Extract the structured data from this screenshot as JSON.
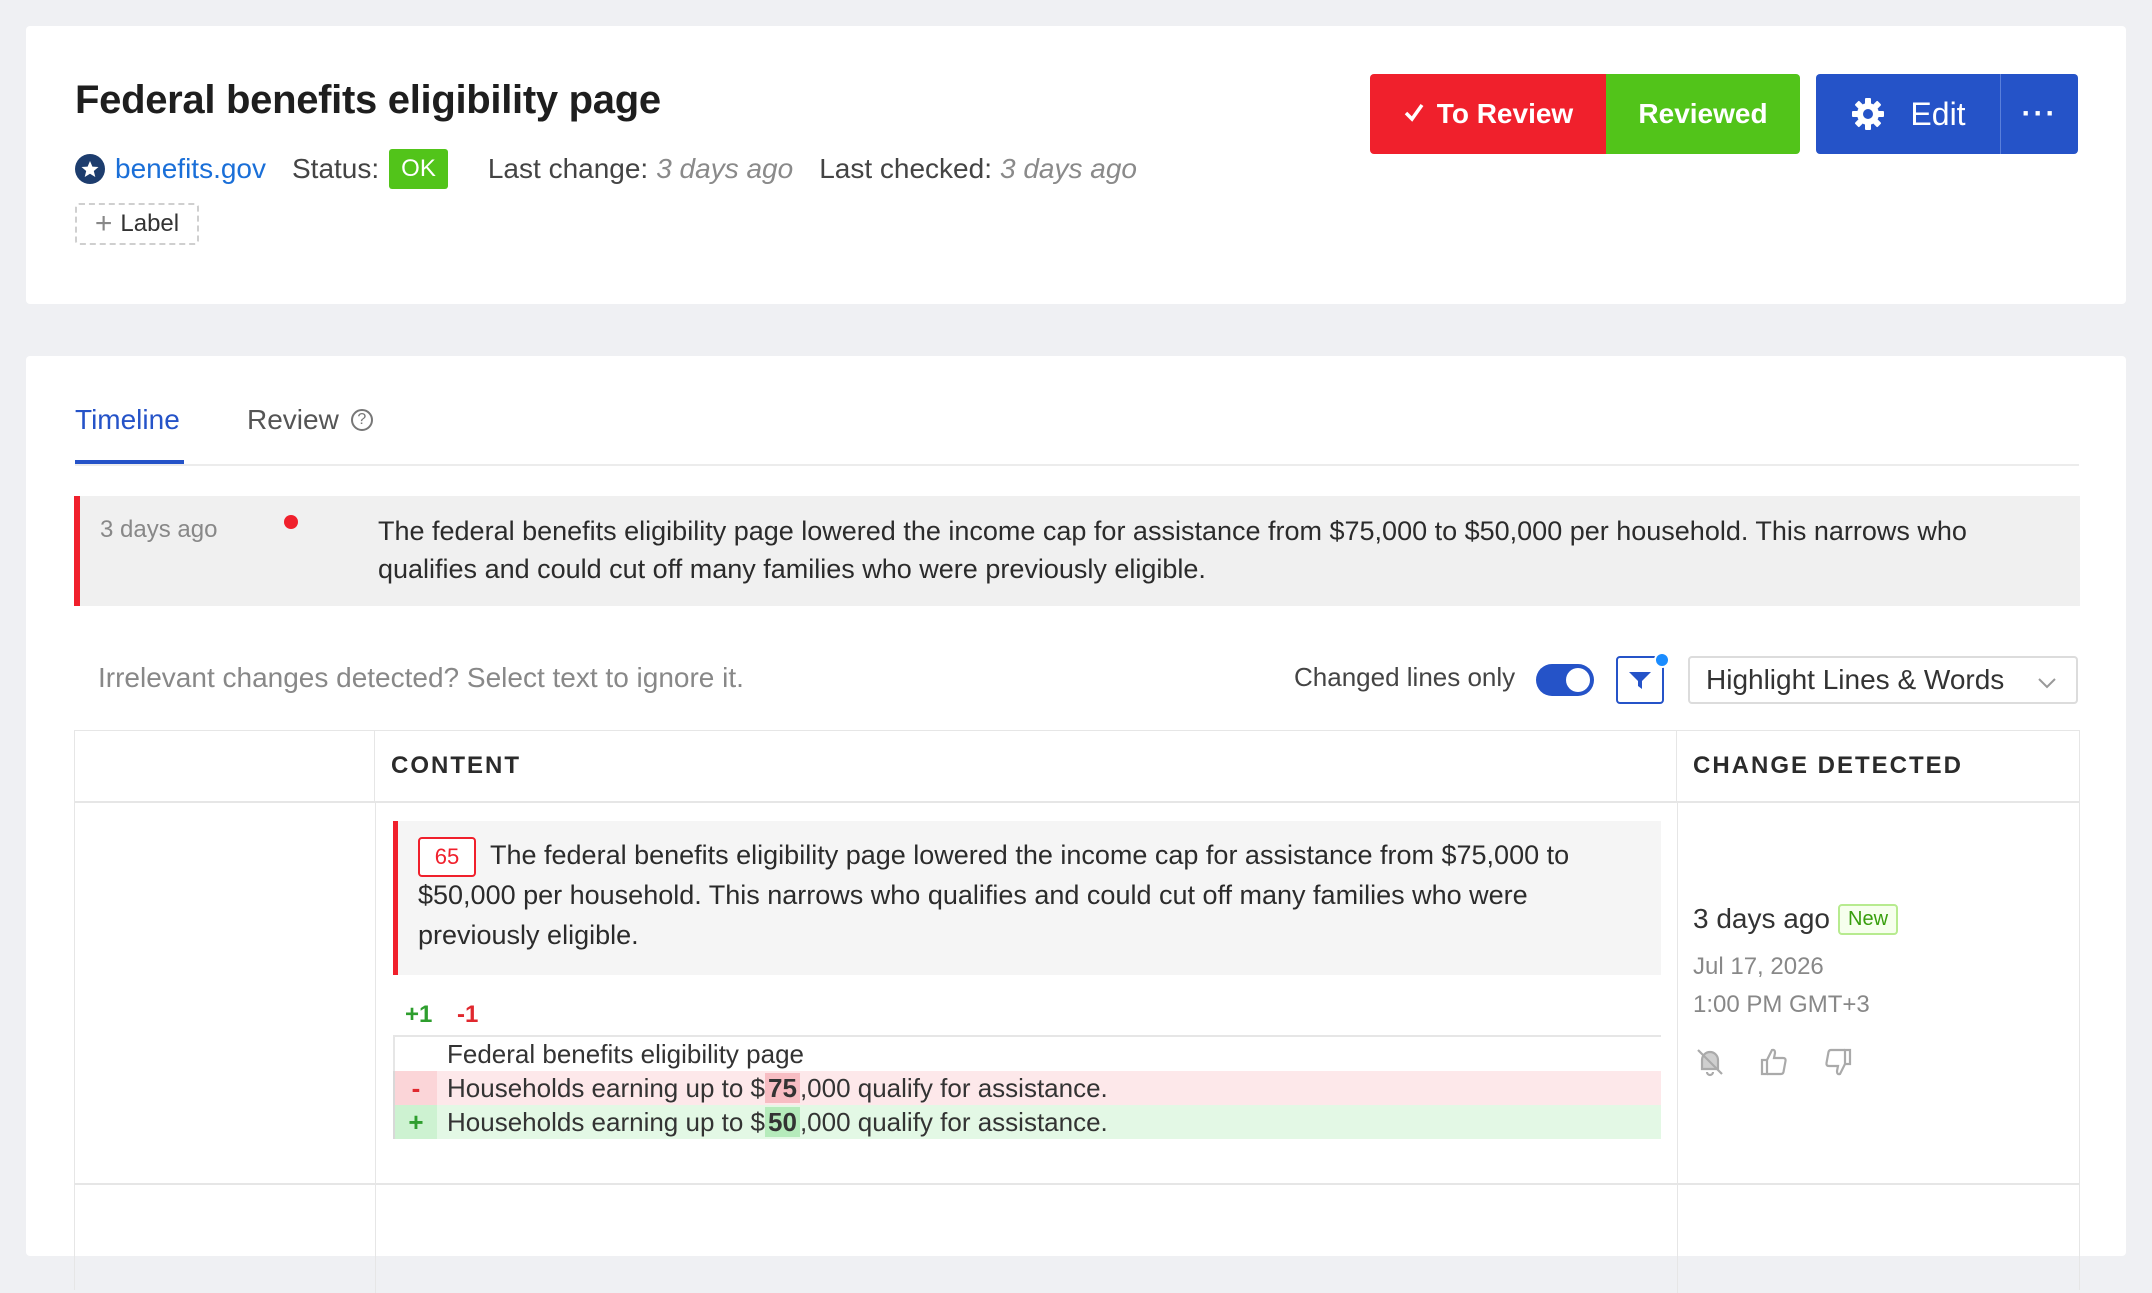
{
  "header": {
    "title": "Federal benefits eligibility page",
    "site": "benefits.gov",
    "status_label": "Status:",
    "status": "OK",
    "last_change_label": "Last change:",
    "last_change": "3 days ago",
    "last_checked_label": "Last checked:",
    "last_checked": "3 days ago",
    "label_button": "Label",
    "to_review": "To Review",
    "reviewed": "Reviewed",
    "edit": "Edit",
    "more": "···"
  },
  "tabs": [
    {
      "label": "Timeline",
      "active": true
    },
    {
      "label": "Review",
      "active": false
    }
  ],
  "summary": {
    "time": "3 days ago",
    "text": "The federal benefits eligibility page lowered the income cap for assistance from $75,000 to $50,000 per household. This narrows who qualifies and could cut off many families who were previously eligible."
  },
  "toolbar": {
    "hint": "Irrelevant changes detected? Select text to ignore it.",
    "changed_lines_label": "Changed lines only",
    "changed_lines_on": true,
    "highlight_mode": "Highlight Lines & Words"
  },
  "table": {
    "columns": [
      "",
      "CONTENT",
      "CHANGE DETECTED"
    ],
    "row": {
      "line_number": "65",
      "change_text": "The federal benefits eligibility page lowered the income cap for assistance from $75,000 to $50,000 per household. This narrows who qualifies and could cut off many families who were previously eligible.",
      "added_count": "+1",
      "removed_count": "-1",
      "diff": {
        "context": "Federal benefits eligibility page",
        "removed": {
          "sign": "-",
          "before": "Households earning up to $",
          "highlight": "75",
          "after": ",000 qualify for assistance."
        },
        "added": {
          "sign": "+",
          "before": "Households earning up to $",
          "highlight": "50",
          "after": ",000 qualify for assistance."
        }
      },
      "detected_relative": "3 days ago",
      "new_badge": "New",
      "detected_date": "Jul 17, 2026",
      "detected_time": "1:00 PM GMT+3"
    }
  },
  "colors": {
    "accent": "#2553c8",
    "danger": "#f0202c",
    "success": "#52c41a"
  },
  "icons": [
    "site-star-icon",
    "checkmark-icon",
    "gear-icon",
    "more-icon",
    "plus-icon",
    "help-icon",
    "filter-icon",
    "chevron-down-icon",
    "mute-notification-icon",
    "thumbs-up-icon",
    "thumbs-down-icon"
  ]
}
